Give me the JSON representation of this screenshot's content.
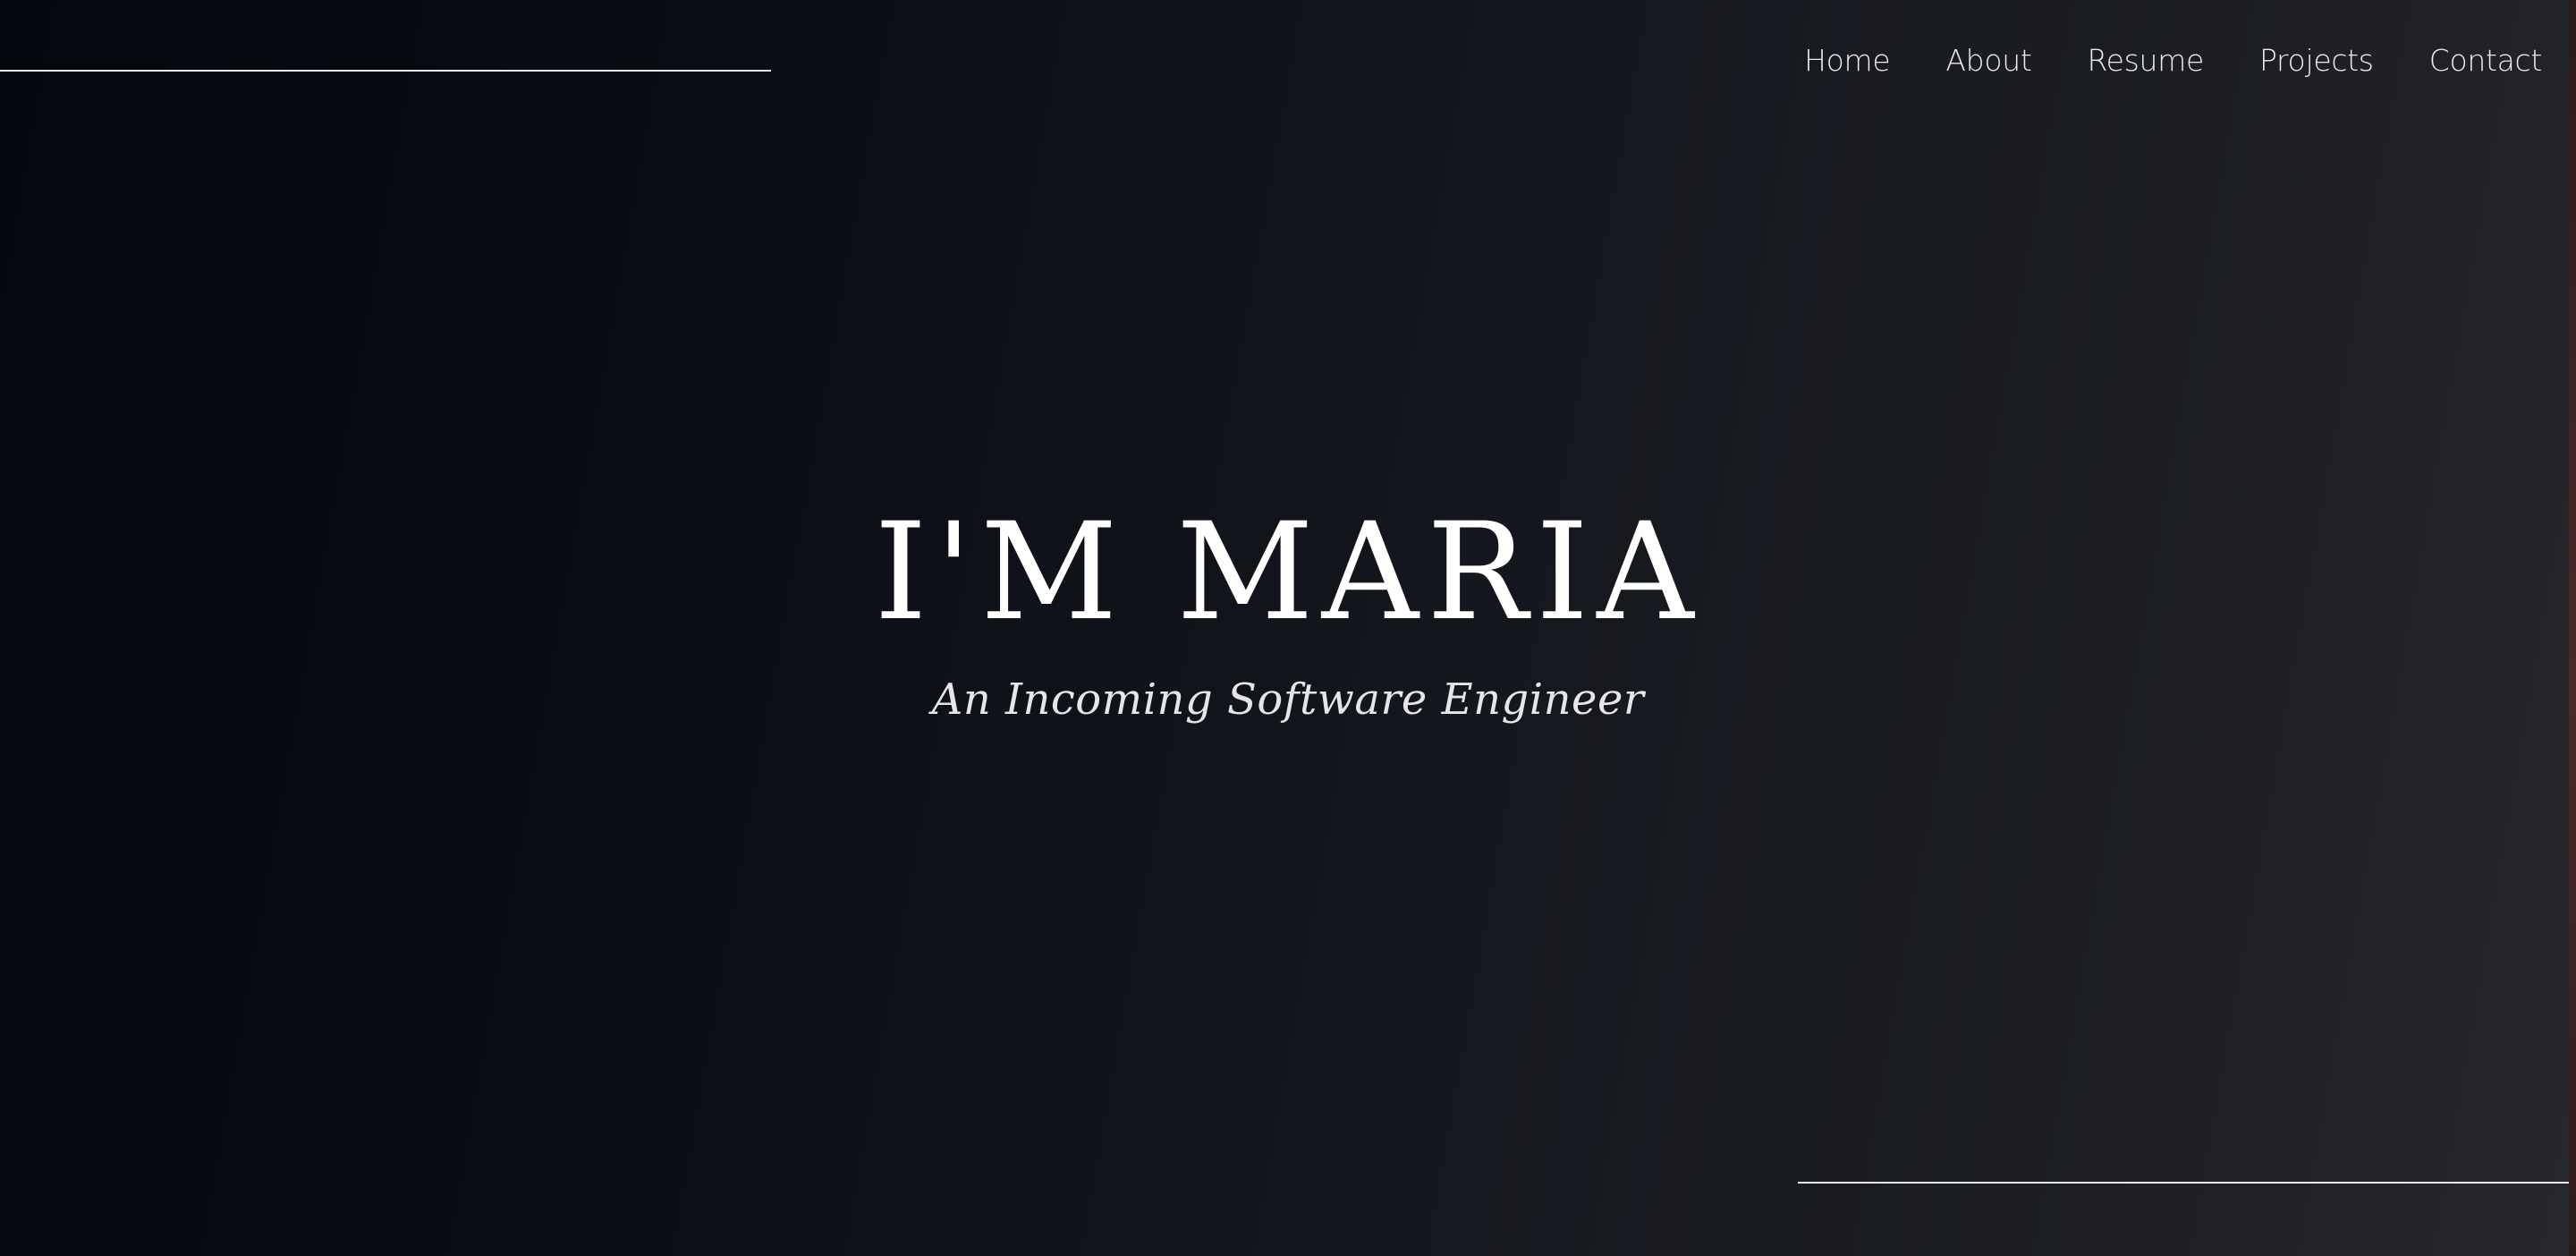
{
  "nav": {
    "items": [
      {
        "label": "Home"
      },
      {
        "label": "About"
      },
      {
        "label": "Resume"
      },
      {
        "label": "Projects"
      },
      {
        "label": "Contact"
      }
    ]
  },
  "hero": {
    "title": "I'M MARIA",
    "subtitle": "An Incoming Software Engineer"
  },
  "colors": {
    "background_dark": "#05070f",
    "background_light": "#26282b",
    "text": "#ffffff",
    "line": "#e8e8e8"
  }
}
